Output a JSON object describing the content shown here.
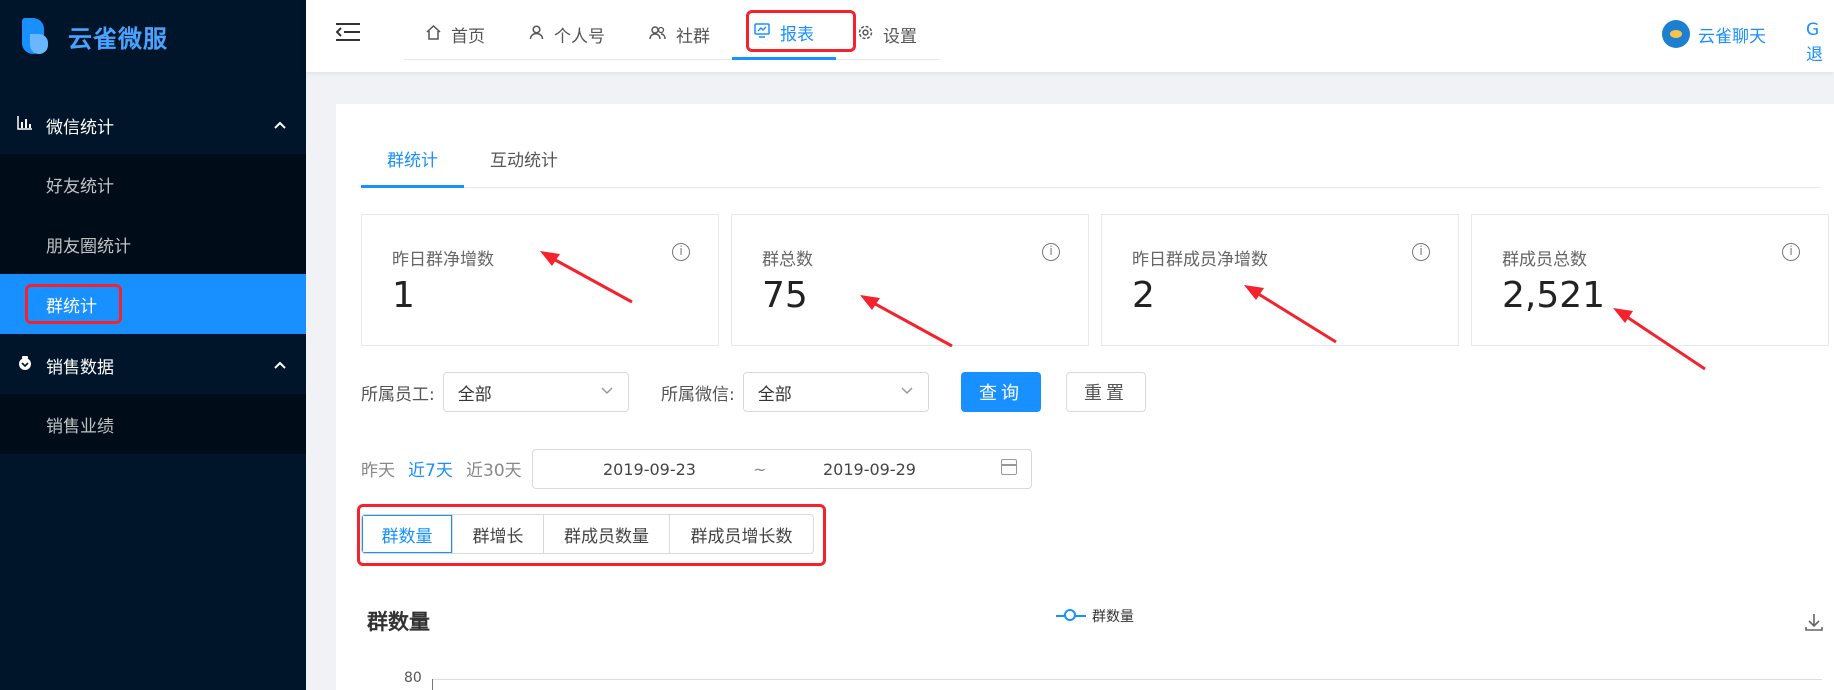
{
  "brand": {
    "name": "云雀微服"
  },
  "sidebar": {
    "groups": [
      {
        "label": "微信统计",
        "icon": "bar-chart-icon",
        "expanded": true,
        "items": [
          {
            "label": "好友统计"
          },
          {
            "label": "朋友圈统计"
          },
          {
            "label": "群统计",
            "active": true
          }
        ]
      },
      {
        "label": "销售数据",
        "icon": "wallet-icon",
        "expanded": true,
        "items": [
          {
            "label": "销售业绩"
          }
        ]
      }
    ]
  },
  "header": {
    "nav": [
      {
        "label": "首页",
        "icon": "home-icon"
      },
      {
        "label": "个人号",
        "icon": "user-icon"
      },
      {
        "label": "社群",
        "icon": "team-icon"
      },
      {
        "label": "报表",
        "icon": "report-icon",
        "active": true
      },
      {
        "label": "设置",
        "icon": "settings-icon"
      }
    ],
    "user_name": "云雀聊天",
    "extra": "G退"
  },
  "tabs": [
    {
      "label": "群统计",
      "active": true
    },
    {
      "label": "互动统计"
    }
  ],
  "stats": [
    {
      "label": "昨日群净增数",
      "value": "1"
    },
    {
      "label": "群总数",
      "value": "75"
    },
    {
      "label": "昨日群成员净增数",
      "value": "2"
    },
    {
      "label": "群成员总数",
      "value": "2,521"
    }
  ],
  "filters": {
    "staff_label": "所属员工:",
    "staff_value": "全部",
    "wechat_label": "所属微信:",
    "wechat_value": "全部",
    "query_label": "查询",
    "reset_label": "重置"
  },
  "date": {
    "quick": [
      {
        "label": "昨天"
      },
      {
        "label": "近7天",
        "active": true
      },
      {
        "label": "近30天"
      }
    ],
    "start": "2019-09-23",
    "separator": "~",
    "end": "2019-09-29"
  },
  "segments": [
    {
      "label": "群数量",
      "active": true
    },
    {
      "label": "群增长"
    },
    {
      "label": "群成员数量"
    },
    {
      "label": "群成员增长数"
    }
  ],
  "chart": {
    "title": "群数量",
    "legend": "群数量",
    "y_top_tick": "80"
  },
  "colors": {
    "primary": "#1890ff",
    "sidebar_bg": "#001529",
    "highlight": "#f5222d"
  }
}
